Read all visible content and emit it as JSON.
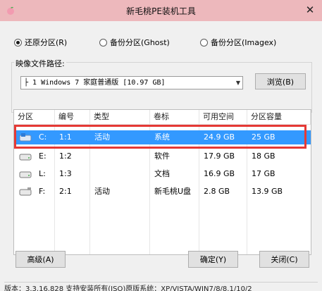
{
  "window": {
    "title": "新毛桃PE装机工具",
    "close_glyph": "✕"
  },
  "mode": {
    "options": [
      {
        "label": "还原分区(R)",
        "selected": true
      },
      {
        "label": "备份分区(Ghost)",
        "selected": false
      },
      {
        "label": "备份分区(Imagex)",
        "selected": false
      }
    ]
  },
  "image": {
    "label": "映像文件路径:",
    "selected": "├ 1 Windows 7 家庭普通版 [10.97 GB]",
    "browse_label": "浏览(B)"
  },
  "table": {
    "columns": [
      "分区",
      "编号",
      "类型",
      "卷标",
      "可用空间",
      "分区容量"
    ],
    "rows": [
      {
        "drive": "C:",
        "num": "1:1",
        "type": "活动",
        "label": "系统",
        "free": "24.9 GB",
        "size": "25 GB",
        "selected": true,
        "icon": "windows-drive-icon"
      },
      {
        "drive": "E:",
        "num": "1:2",
        "type": "",
        "label": "软件",
        "free": "17.9 GB",
        "size": "18 GB",
        "selected": false,
        "icon": "hard-drive-icon"
      },
      {
        "drive": "L:",
        "num": "1:3",
        "type": "",
        "label": "文档",
        "free": "16.9 GB",
        "size": "17 GB",
        "selected": false,
        "icon": "hard-drive-icon"
      },
      {
        "drive": "F:",
        "num": "2:1",
        "type": "活动",
        "label": "新毛桃U盘",
        "free": "2.8 GB",
        "size": "13.9 GB",
        "selected": false,
        "icon": "usb-drive-icon"
      }
    ]
  },
  "buttons": {
    "advanced": "高级(A)",
    "ok": "确定(Y)",
    "close": "关闭(C)"
  },
  "status": {
    "text": "版本：3.3.16.828     支持安装所有(ISO)原版系统：XP/VISTA/WIN7/8/8.1/10/2"
  },
  "colors": {
    "titlebar": "#edb8bc",
    "selection": "#3399ff",
    "highlight": "#e53935"
  }
}
